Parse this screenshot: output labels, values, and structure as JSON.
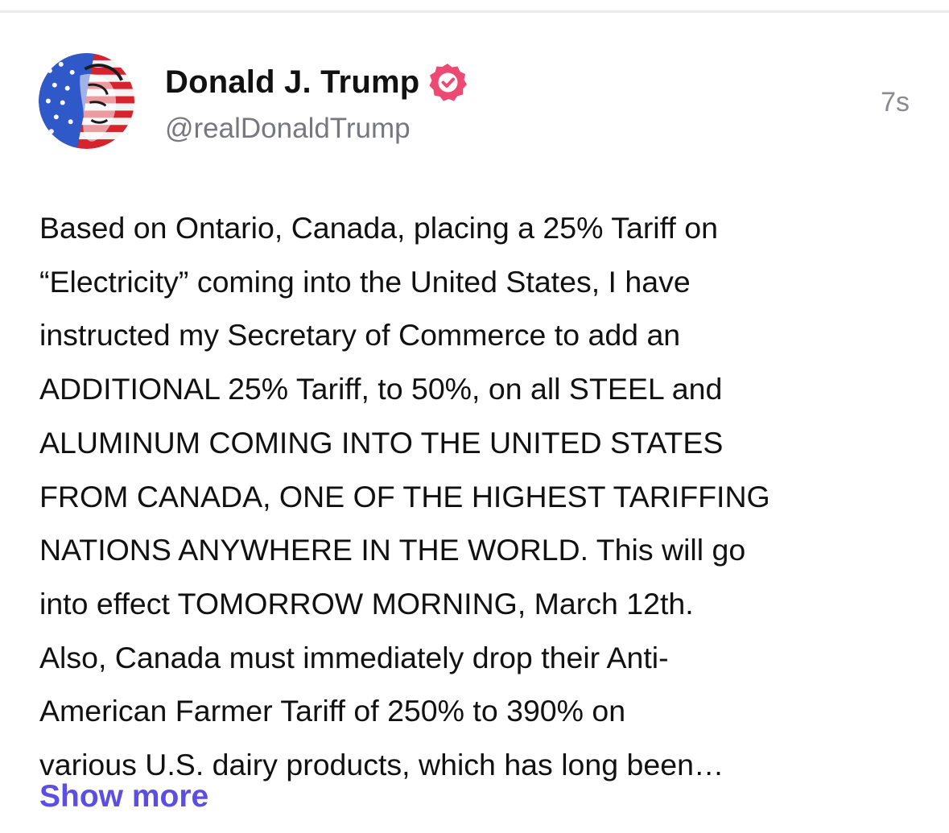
{
  "post": {
    "author": {
      "display_name": "Donald J. Trump",
      "handle": "@realDonaldTrump",
      "verified": true,
      "verified_badge_color": "#ec4a72",
      "avatar_icon": "avatar-flag-portrait"
    },
    "timestamp": "7s",
    "body_lines": [
      "Based on Ontario, Canada, placing a 25% Tariff on",
      "“Electricity” coming into the United States, I have",
      "instructed my Secretary of Commerce to add an",
      "ADDITIONAL 25% Tariff, to 50%, on all STEEL and",
      "ALUMINUM COMING INTO THE UNITED STATES",
      "FROM CANADA, ONE OF THE HIGHEST TARIFFING",
      "NATIONS ANYWHERE IN THE WORLD. This will go",
      "into effect TOMORROW MORNING, March 12th.",
      "Also, Canada must immediately drop their Anti-",
      "American Farmer Tariff of 250% to 390% on",
      "various U.S. dairy products, which has long been…"
    ],
    "show_more_label": "Show more",
    "link_color": "#5b4ee0"
  }
}
